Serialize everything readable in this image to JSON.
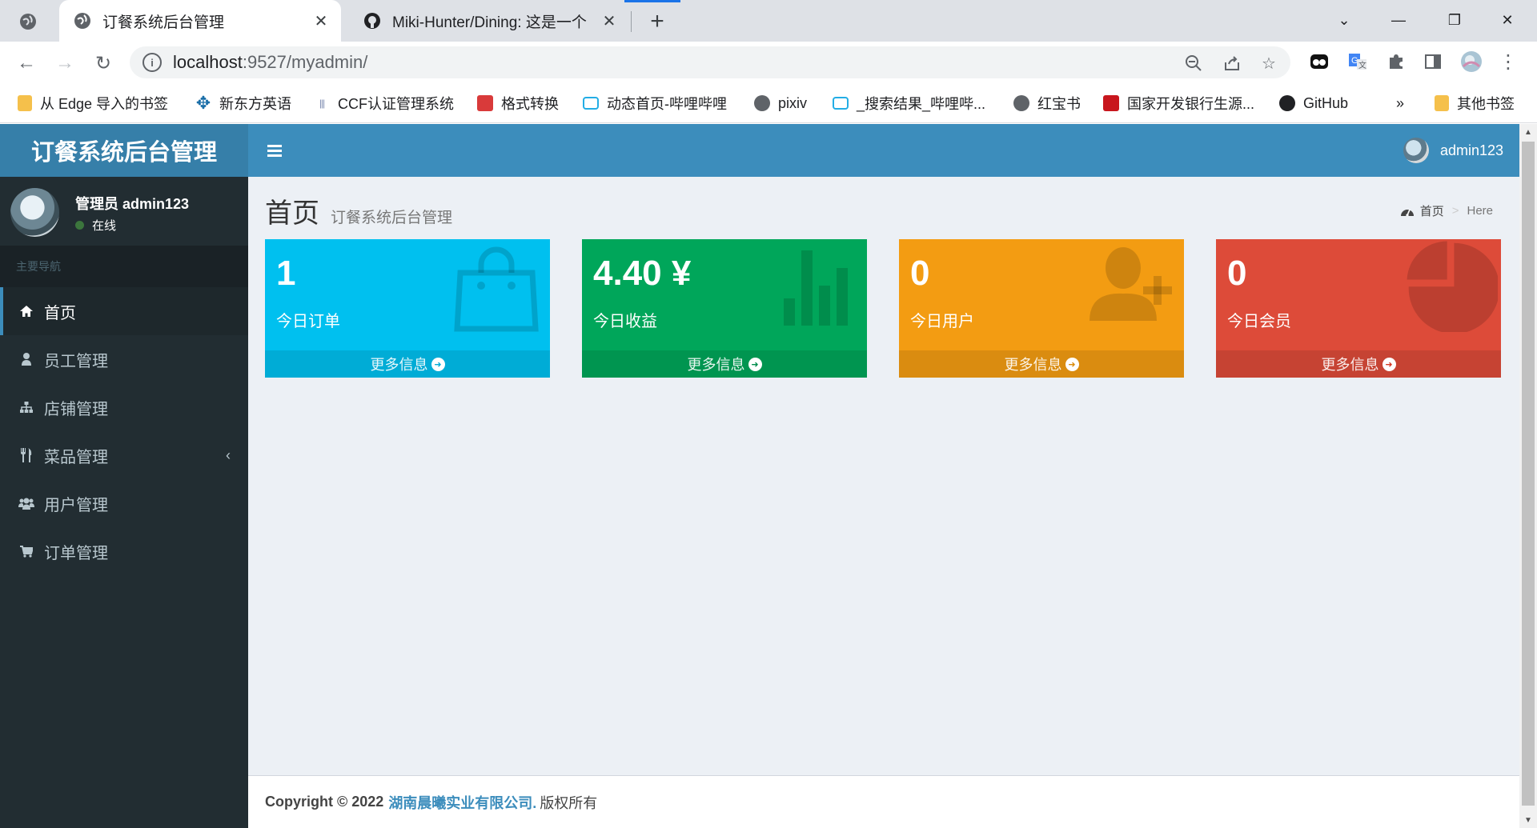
{
  "browser": {
    "active_tab_title": "订餐系统后台管理",
    "inactive_tab_title": "Miki-Hunter/Dining: 这是一个",
    "url_host": "localhost",
    "url_path": ":9527/myadmin/",
    "bookmarks": [
      {
        "label": "从 Edge 导入的书签",
        "icon": "folder-icon",
        "color": "#f5c04b"
      },
      {
        "label": "新东方英语",
        "icon": "compass-icon",
        "color": "#1a6ea8"
      },
      {
        "label": "CCF认证管理系统",
        "icon": "ccf-icon",
        "color": "#7d8bb0"
      },
      {
        "label": "格式转换",
        "icon": "cube-icon",
        "color": "#d93a3a"
      },
      {
        "label": "动态首页-哔哩哔哩",
        "icon": "bilibili-icon",
        "color": "#23ade5"
      },
      {
        "label": "pixiv",
        "icon": "globe-icon",
        "color": "#5f6368"
      },
      {
        "label": "_搜索结果_哔哩哔...",
        "icon": "bilibili-icon",
        "color": "#23ade5"
      },
      {
        "label": "红宝书",
        "icon": "globe-icon",
        "color": "#5f6368"
      },
      {
        "label": "国家开发银行生源...",
        "icon": "cdb-icon",
        "color": "#c8161d"
      },
      {
        "label": "GitHub",
        "icon": "github-icon",
        "color": "#202124"
      }
    ],
    "overflow_label": "»",
    "other_bookmarks": "其他书签"
  },
  "app": {
    "logo": "订餐系统后台管理",
    "top_user": "admin123",
    "panel_user": "管理员 admin123",
    "panel_status": "在线",
    "nav_header": "主要导航",
    "menu": [
      {
        "label": "首页",
        "icon": "home-icon",
        "active": true
      },
      {
        "label": "员工管理",
        "icon": "user-icon"
      },
      {
        "label": "店铺管理",
        "icon": "sitemap-icon"
      },
      {
        "label": "菜品管理",
        "icon": "cutlery-icon",
        "has_children": true
      },
      {
        "label": "用户管理",
        "icon": "users-icon"
      },
      {
        "label": "订单管理",
        "icon": "cart-icon"
      }
    ]
  },
  "content": {
    "title": "首页",
    "subtitle": "订餐系统后台管理",
    "breadcrumb_home": "首页",
    "breadcrumb_sep": ">",
    "breadcrumb_here": "Here",
    "boxes": [
      {
        "value": "1",
        "label": "今日订单",
        "more": "更多信息",
        "color": "#00c0ef",
        "icon": "shopping-bag-icon"
      },
      {
        "value": "4.40 ¥",
        "label": "今日收益",
        "more": "更多信息",
        "color": "#00a65a",
        "icon": "bar-chart-icon"
      },
      {
        "value": "0",
        "label": "今日用户",
        "more": "更多信息",
        "color": "#f39c12",
        "icon": "user-add-icon"
      },
      {
        "value": "0",
        "label": "今日会员",
        "more": "更多信息",
        "color": "#dd4b39",
        "icon": "pie-chart-icon"
      }
    ]
  },
  "footer": {
    "copyright": "Copyright © 2022",
    "company": "湖南晨曦实业有限公司.",
    "rights": "版权所有"
  }
}
